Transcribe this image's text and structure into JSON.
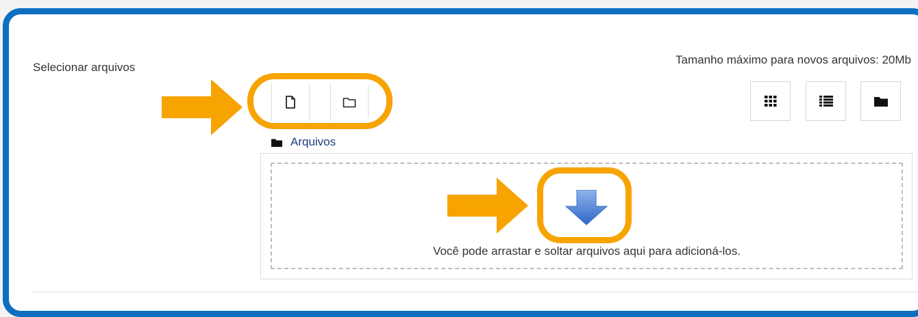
{
  "filepicker": {
    "label": "Selecionar arquivos",
    "max_size": "Tamanho máximo para novos arquivos: 20Mb",
    "toolbar": {
      "add_file_icon": "file-add-icon",
      "create_folder_icon": "folder-create-icon"
    },
    "view_buttons": [
      "grid-view-icon",
      "list-view-icon",
      "tree-view-icon"
    ],
    "path_label": "Arquivos",
    "dropzone_text": "Você pode arrastar e soltar arquivos aqui para adicioná-los."
  },
  "colors": {
    "frame": "#0c6fc0",
    "highlight": "#f7a300",
    "link": "#1a3c7a"
  }
}
